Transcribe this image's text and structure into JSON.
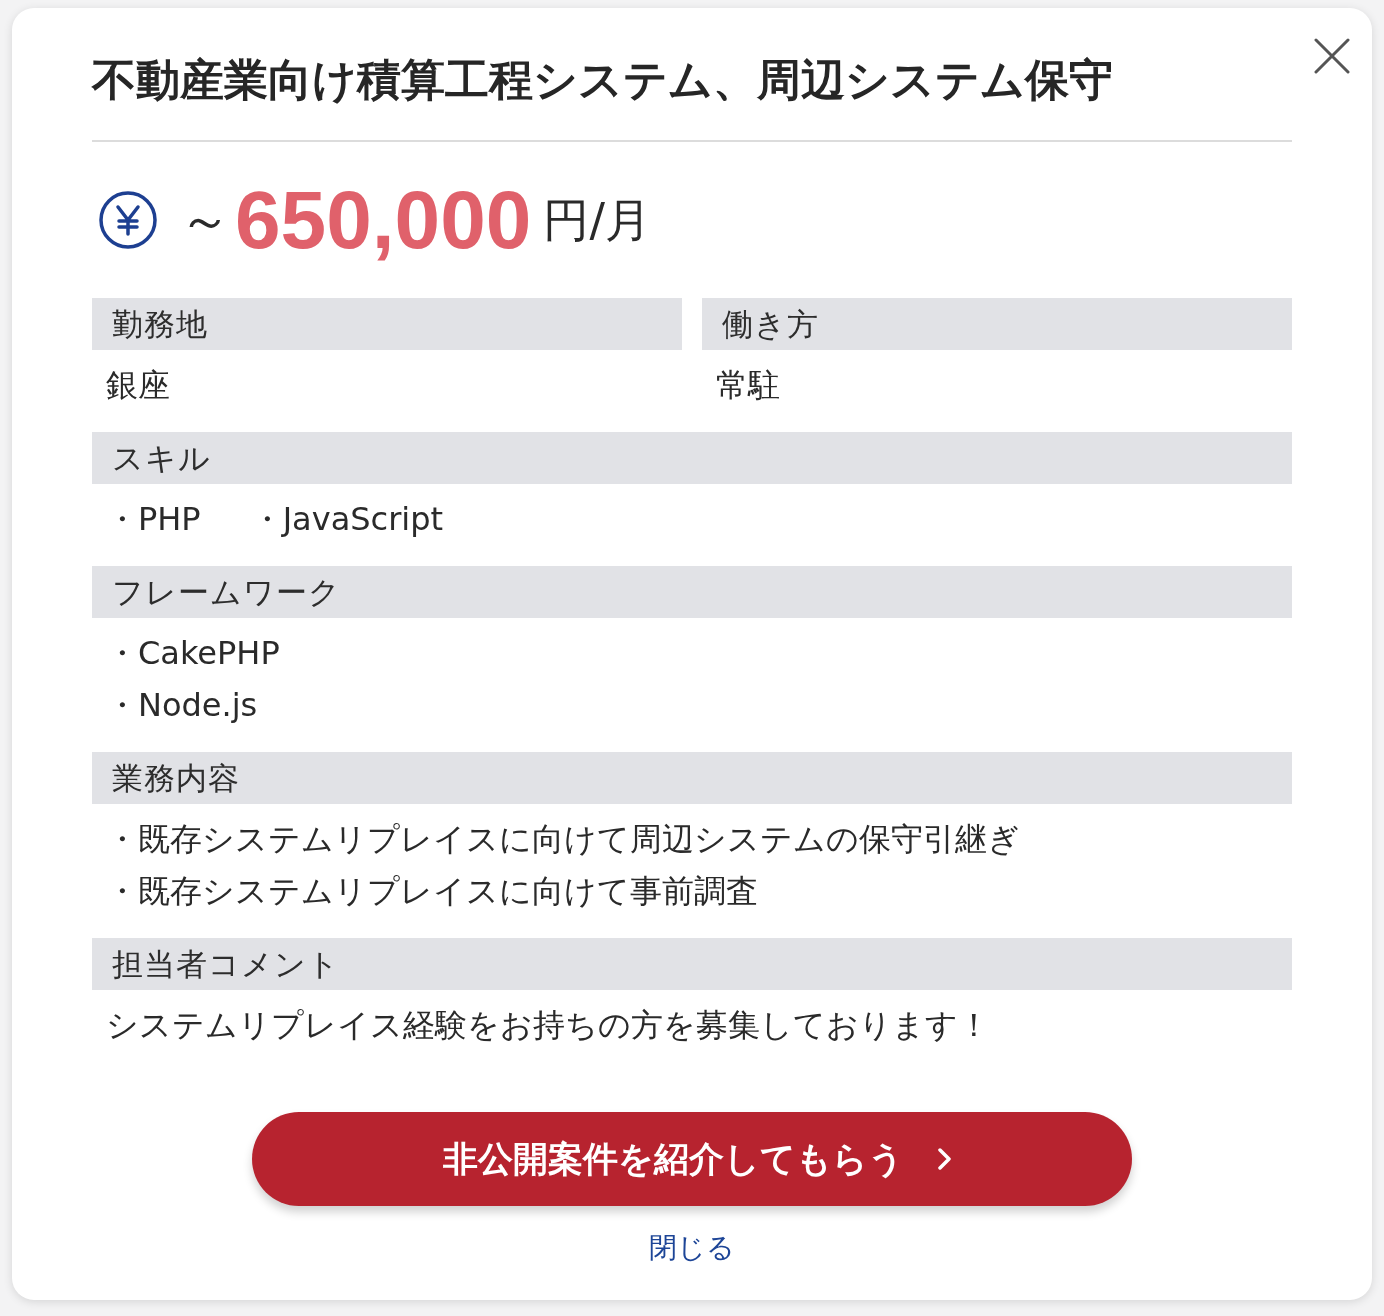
{
  "title": "不動産業向け積算工程システム、周辺システム保守",
  "salary": {
    "prefix": "～",
    "amount": "650,000",
    "unit": "円/月"
  },
  "sections": [
    {
      "kind": "pair",
      "columns": [
        {
          "label": "勤務地",
          "value": "銀座"
        },
        {
          "label": "働き方",
          "value": "常駐"
        }
      ]
    },
    {
      "kind": "inline",
      "label": "スキル",
      "items": [
        "・PHP",
        "・JavaScript"
      ]
    },
    {
      "kind": "list",
      "label": "フレームワーク",
      "items": [
        "・CakePHP",
        "・Node.js"
      ]
    },
    {
      "kind": "list",
      "label": "業務内容",
      "items": [
        "・既存システムリプレイスに向けて周辺システムの保守引継ぎ",
        "・既存システムリプレイスに向けて事前調査"
      ]
    },
    {
      "kind": "text",
      "label": "担当者コメント",
      "value": "システムリプレイス経験をお持ちの方を募集しております！"
    }
  ],
  "cta_button": {
    "label": "非公開案件を紹介してもらう"
  },
  "close_link": {
    "label": "閉じる"
  }
}
